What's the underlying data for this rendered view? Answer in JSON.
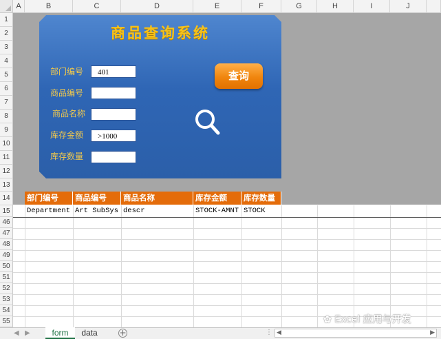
{
  "columns": [
    "A",
    "B",
    "C",
    "D",
    "E",
    "F",
    "G",
    "H",
    "I",
    "J"
  ],
  "rows_top": [
    "1",
    "2",
    "3",
    "4",
    "5",
    "6",
    "7",
    "8",
    "9",
    "10",
    "11",
    "12",
    "13",
    "14"
  ],
  "rows_bottom": [
    "15",
    "46",
    "47",
    "48",
    "49",
    "50",
    "51",
    "52",
    "53",
    "54",
    "55"
  ],
  "form": {
    "title": "商品查询系统",
    "fields": [
      {
        "label": "部门编号",
        "value": "401"
      },
      {
        "label": "商品编号",
        "value": ""
      },
      {
        "label": "商品名称",
        "value": ""
      },
      {
        "label": "库存金额",
        "value": ">1000"
      },
      {
        "label": "库存数量",
        "value": ""
      }
    ],
    "query_button": "查询",
    "search_icon": "magnifier-icon"
  },
  "table": {
    "headers": [
      "部门编号",
      "商品编号",
      "商品名称",
      "库存金额",
      "库存数量"
    ],
    "row": [
      "Department",
      "Art SubSys",
      "descr",
      "STOCK-AMNT",
      "STOCK"
    ]
  },
  "sheets": {
    "tabs": [
      "form",
      "data"
    ],
    "active": "form",
    "add_symbol": "+"
  },
  "watermark": "Excel 应用与开发",
  "colors": {
    "panel": "#2f66b5",
    "title": "#f6c21b",
    "header_orange": "#e46c0a",
    "button_orange": "#f0850e",
    "active_tab": "#217346"
  }
}
